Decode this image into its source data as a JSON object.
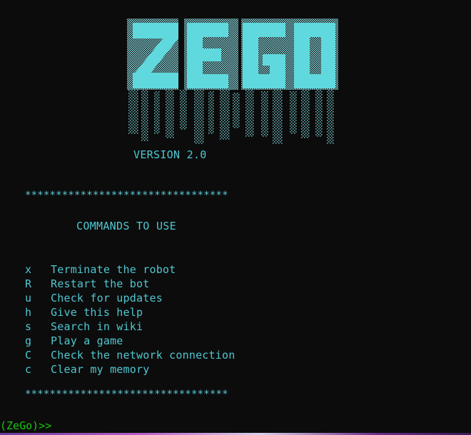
{
  "banner": {
    "logo_text": "ZEGO",
    "version": "VERSION 2.0"
  },
  "separator": "*********************************",
  "commands": {
    "title": "COMMANDS TO USE",
    "items": [
      {
        "key": "x",
        "desc": "Terminate the robot"
      },
      {
        "key": "R",
        "desc": "Restart the bot"
      },
      {
        "key": "u",
        "desc": "Check for updates"
      },
      {
        "key": "h",
        "desc": "Give this help"
      },
      {
        "key": "s",
        "desc": "Search in wiki"
      },
      {
        "key": "g",
        "desc": "Play a game"
      },
      {
        "key": "C",
        "desc": "Check the network connection"
      },
      {
        "key": "c",
        "desc": "Clear my memory"
      }
    ]
  },
  "prompt": "(ZeGo)>>",
  "colors": {
    "accent": "#4fc7d1",
    "prompt": "#16c60c",
    "background": "#0c0c0c"
  }
}
